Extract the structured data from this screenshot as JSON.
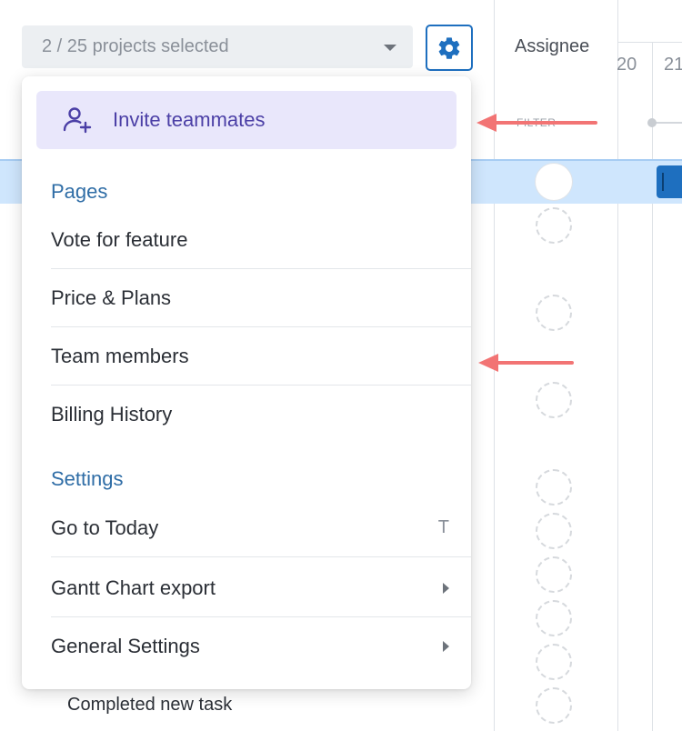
{
  "header": {
    "projects_selector": "2 / 25 projects selected",
    "assignee_column": "Assignee",
    "filter_label": "FILTER",
    "timeline_days": [
      "20",
      "21"
    ]
  },
  "menu": {
    "invite_label": "Invite teammates",
    "pages_title": "Pages",
    "pages_items": [
      "Vote for feature",
      "Price & Plans",
      "Team members",
      "Billing History"
    ],
    "settings_title": "Settings",
    "settings_items": [
      {
        "label": "Go to Today",
        "shortcut": "T"
      },
      {
        "label": "Gantt Chart export",
        "submenu": true
      },
      {
        "label": "General Settings",
        "submenu": true
      }
    ]
  },
  "background": {
    "task_label": "Completed new task"
  },
  "colors": {
    "accent": "#1e6fbf",
    "invite_bg": "#e9e7fb",
    "invite_text": "#4b3fa6",
    "section_title": "#2f6da6",
    "selected_row": "#cfe6fd",
    "annotation_arrow": "#f27474"
  },
  "icons": {
    "settings": "gear-icon",
    "invite": "user-plus-icon",
    "selector": "chevron-down-icon",
    "submenu": "chevron-right-icon"
  }
}
